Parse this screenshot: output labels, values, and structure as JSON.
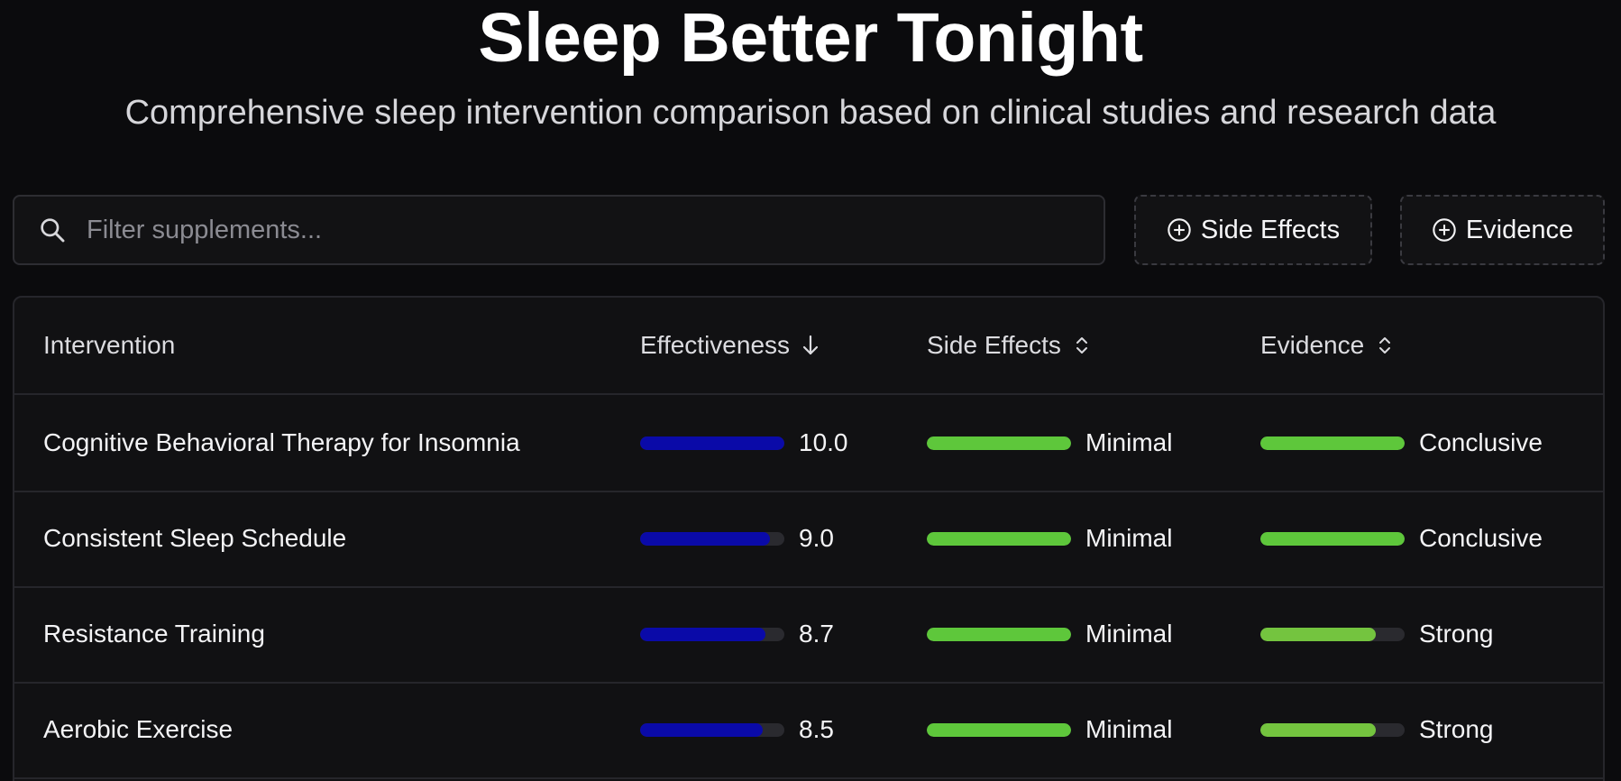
{
  "header": {
    "title": "Sleep Better Tonight",
    "subtitle": "Comprehensive sleep intervention comparison based on clinical studies and research data"
  },
  "search": {
    "placeholder": "Filter supplements...",
    "value": "",
    "icon": "search-icon"
  },
  "filters": [
    {
      "label": "Side Effects",
      "icon": "plus-circle-icon"
    },
    {
      "label": "Evidence",
      "icon": "plus-circle-icon"
    }
  ],
  "table": {
    "columns": [
      {
        "label": "Intervention",
        "sort": "none"
      },
      {
        "label": "Effectiveness",
        "sort": "descending"
      },
      {
        "label": "Side Effects",
        "sort": "sortable"
      },
      {
        "label": "Evidence",
        "sort": "sortable"
      }
    ],
    "rows": [
      {
        "name": "Cognitive Behavioral Therapy for Insomnia",
        "effectiveness": 10.0,
        "effectiveness_label": "10.0",
        "side_effects": "Minimal",
        "side_effects_level": 1.0,
        "evidence": "Conclusive",
        "evidence_level": 1.0
      },
      {
        "name": "Consistent Sleep Schedule",
        "effectiveness": 9.0,
        "effectiveness_label": "9.0",
        "side_effects": "Minimal",
        "side_effects_level": 1.0,
        "evidence": "Conclusive",
        "evidence_level": 1.0
      },
      {
        "name": "Resistance Training",
        "effectiveness": 8.7,
        "effectiveness_label": "8.7",
        "side_effects": "Minimal",
        "side_effects_level": 1.0,
        "evidence": "Strong",
        "evidence_level": 0.8
      },
      {
        "name": "Aerobic Exercise",
        "effectiveness": 8.5,
        "effectiveness_label": "8.5",
        "side_effects": "Minimal",
        "side_effects_level": 1.0,
        "evidence": "Strong",
        "evidence_level": 0.8
      }
    ]
  },
  "colors": {
    "background": "#0b0b0d",
    "effectiveness_bar": "#0a0aa8",
    "minimal_bar": "#5ec73b",
    "conclusive_bar": "#5ec73b",
    "strong_bar": "#74c43f",
    "track": "#2a2a2f"
  }
}
